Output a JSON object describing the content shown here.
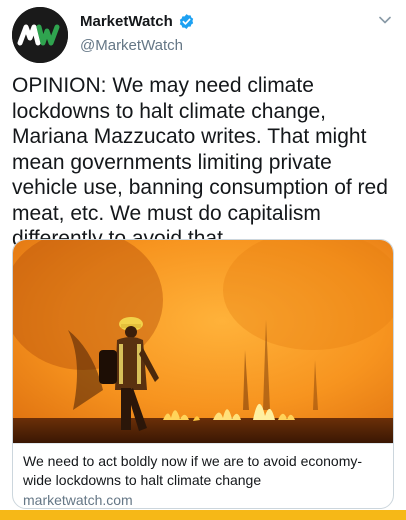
{
  "account": {
    "display_name": "MarketWatch",
    "handle": "@MarketWatch",
    "avatar_logo_text": "MW",
    "verified": true
  },
  "tweet": {
    "text": "OPINION: We may need climate lockdowns to halt climate change, Mariana Mazzucato writes. That might mean governments limiting private vehicle use, banning consumption of red meat, etc. We must do capitalism differently to avoid that."
  },
  "card": {
    "title": "We need to act boldly now if we are to avoid economy-wide lockdowns to halt climate change",
    "domain": "marketwatch.com"
  },
  "icons": {
    "verified": "verified-badge-icon",
    "caret": "chevron-down-icon"
  },
  "colors": {
    "link_blue": "#1da1f2",
    "brand_green": "#2fa44f",
    "secondary_text": "#657786",
    "bottom_bar": "#f6b817"
  }
}
